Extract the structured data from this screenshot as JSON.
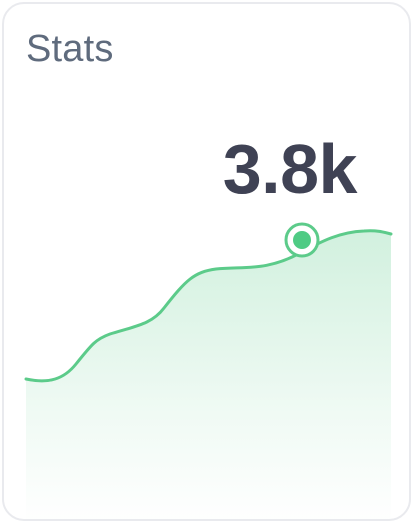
{
  "card": {
    "title": "Stats",
    "value": "3.8k"
  },
  "colors": {
    "title": "#5f6b7d",
    "value": "#3f4254",
    "line": "#5ccb8a",
    "marker_fill": "#4fcb84",
    "card_border": "#e9eaee"
  },
  "icons": {
    "highlight_marker": "ring-dot-icon"
  }
}
